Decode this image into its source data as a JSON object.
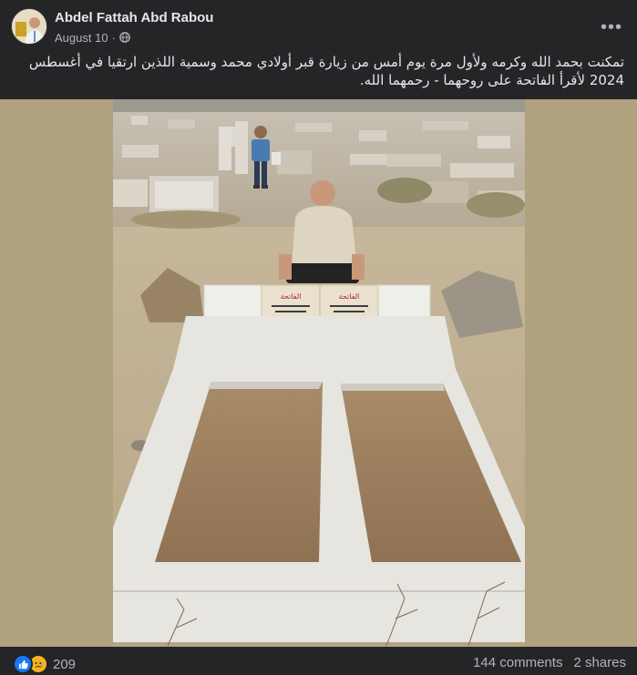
{
  "post": {
    "author": "Abdel Fattah Abd Rabou",
    "date": "August 10",
    "separator": "·",
    "privacy_icon": "globe-icon",
    "more_icon": "more-horizontal-icon",
    "more_label": "•••",
    "caption": "تمكنت بحمد الله وكرمه ولأول مرة يوم أمس من زيارة قبر أولادي محمد وسمية اللذين ارتقيا في أغسطس 2024 لأقرأ الفاتحة على روحهما - رحمهما الله."
  },
  "photo": {
    "plaque_heading_left": "الفاتحة",
    "plaque_heading_right": "الفاتحة"
  },
  "footer": {
    "reaction_icons": [
      "like-icon",
      "sad-icon"
    ],
    "reaction_count": "209",
    "comments": "144 comments",
    "shares": "2 shares"
  },
  "colors": {
    "background": "#242526",
    "photo_backdrop": "#b0a17f",
    "like_blue": "#1877f2",
    "sad_yellow": "#f7b125",
    "secondary_text": "#b0b3b8"
  }
}
